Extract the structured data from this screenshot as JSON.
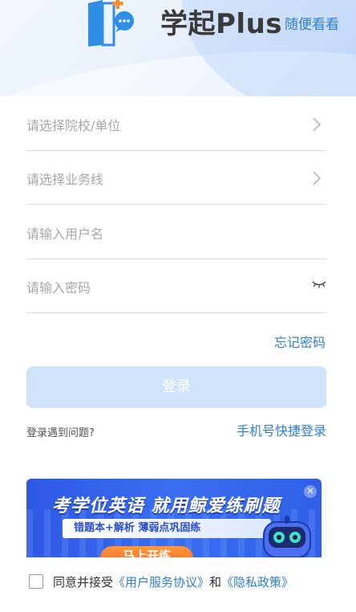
{
  "header": {
    "app_name": "学起Plus",
    "browse_link": "随便看看"
  },
  "form": {
    "school_placeholder": "请选择院校/单位",
    "business_placeholder": "请选择业务线",
    "username_placeholder": "请输入用户名",
    "password_placeholder": "请输入密码"
  },
  "links": {
    "forgot_password": "忘记密码",
    "login_problem": "登录遇到问题?",
    "phone_login": "手机号快捷登录"
  },
  "login_button": "登录",
  "banner": {
    "title": "考学位英语 就用鲸爱练刷题",
    "subtitle": "错题本+解析  薄弱点巩固练",
    "cta": "马上开练"
  },
  "agreement": {
    "prefix": "同意并接受",
    "user_agreement": "《用户服务协议》",
    "and": "和",
    "privacy_policy": "《隐私政策》"
  },
  "colors": {
    "accent": "#2f7fd6",
    "login_button_disabled": "#cfe3fb",
    "banner": "#2e58e4"
  },
  "icons": [
    "app-logo-icon",
    "chevron-right-icon",
    "eye-closed-icon",
    "close-icon",
    "robot-mascot-icon"
  ]
}
